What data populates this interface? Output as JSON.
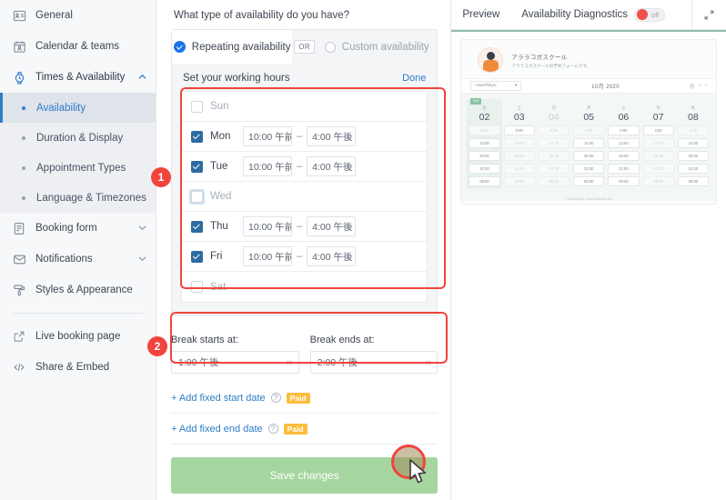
{
  "sidebar": {
    "items": [
      {
        "label": "General",
        "icon": "id-card-icon",
        "type": "group"
      },
      {
        "label": "Calendar & teams",
        "icon": "calendar-person-icon",
        "type": "group"
      },
      {
        "label": "Times & Availability",
        "icon": "watch-icon",
        "type": "group",
        "expanded": true,
        "chevron": "⌃"
      }
    ],
    "sub_items": [
      {
        "label": "Availability",
        "selected": true
      },
      {
        "label": "Duration & Display",
        "selected": false
      },
      {
        "label": "Appointment Types",
        "selected": false
      },
      {
        "label": "Language & Timezones",
        "selected": false
      }
    ],
    "items_after": [
      {
        "label": "Booking form",
        "icon": "form-icon",
        "chevron": "⌄"
      },
      {
        "label": "Notifications",
        "icon": "envelope-icon",
        "chevron": "⌄"
      },
      {
        "label": "Styles & Appearance",
        "icon": "paint-roller-icon",
        "chevron": ""
      }
    ],
    "items_bottom": [
      {
        "label": "Live booking page",
        "icon": "external-link-icon"
      },
      {
        "label": "Share & Embed",
        "icon": "code-icon"
      }
    ]
  },
  "main": {
    "question": "What type of availability do you have?",
    "segments": {
      "repeating": "Repeating availability",
      "or": "OR",
      "custom": "Custom availability"
    },
    "working_hours_title": "Set your working hours",
    "done_label": "Done",
    "days": [
      {
        "day": "Sun",
        "checked": false,
        "focused": false,
        "start": "",
        "end": ""
      },
      {
        "day": "Mon",
        "checked": true,
        "focused": false,
        "start": "10:00 午前",
        "end": "4:00 午後"
      },
      {
        "day": "Tue",
        "checked": true,
        "focused": false,
        "start": "10:00 午前",
        "end": "4:00 午後"
      },
      {
        "day": "Wed",
        "checked": false,
        "focused": true,
        "start": "",
        "end": ""
      },
      {
        "day": "Thu",
        "checked": true,
        "focused": false,
        "start": "10:00 午前",
        "end": "4:00 午後"
      },
      {
        "day": "Fri",
        "checked": true,
        "focused": false,
        "start": "10:00 午前",
        "end": "4:00 午後"
      },
      {
        "day": "Sat",
        "checked": false,
        "focused": false,
        "start": "",
        "end": ""
      }
    ],
    "dash": "–",
    "break": {
      "start_label": "Break starts at:",
      "end_label": "Break ends at:",
      "start_value": "1:00 午後",
      "end_value": "2:00 午後",
      "clear_icon": "×"
    },
    "add_rows": [
      {
        "label": "+ Add fixed start date",
        "help": "?",
        "badge": "Paid"
      },
      {
        "label": "+ Add fixed end date",
        "help": "?",
        "badge": "Paid"
      }
    ],
    "save_label": "Save changes",
    "annotations": [
      {
        "number": "1"
      },
      {
        "number": "2"
      }
    ]
  },
  "right_panel": {
    "tab_preview": "Preview",
    "tab_diagnostics": "Availability Diagnostics",
    "toggle_label": "off",
    "expand_icon": "expand-icon",
    "preview": {
      "title": "アララコガスクール",
      "subtitle": "アララコガスクールの予約フォームです。",
      "timezone": "Asia/Tokyo",
      "month": "10月 2020",
      "view_label": "月",
      "prev": "‹",
      "next": "›",
      "badge": "今日",
      "columns": [
        {
          "dow": "金",
          "day": "02",
          "selected": true,
          "slots": [
            "0:00",
            "14:00",
            "20:00",
            "21:00",
            "08:00"
          ],
          "slot_on": [
            false,
            true,
            true,
            true,
            true
          ]
        },
        {
          "dow": "土",
          "day": "03",
          "selected": false,
          "slots": [
            "0:00",
            "14:00",
            "20:00",
            "21:00",
            "08:00"
          ],
          "slot_on": [
            true,
            false,
            false,
            false,
            false
          ]
        },
        {
          "dow": "日",
          "day": "04",
          "selected": false,
          "dim": true,
          "slots": [
            "0:00",
            "14:00",
            "20:00",
            "21:00",
            "08:00"
          ],
          "slot_on": [
            false,
            false,
            false,
            false,
            false
          ]
        },
        {
          "dow": "月",
          "day": "05",
          "selected": false,
          "slots": [
            "0:00",
            "14:00",
            "20:00",
            "21:00",
            "08:00"
          ],
          "slot_on": [
            false,
            true,
            true,
            true,
            true
          ]
        },
        {
          "dow": "火",
          "day": "06",
          "selected": false,
          "slots": [
            "0:00",
            "14:00",
            "20:00",
            "21:00",
            "08:00"
          ],
          "slot_on": [
            true,
            true,
            true,
            true,
            true
          ]
        },
        {
          "dow": "水",
          "day": "07",
          "selected": false,
          "slots": [
            "0:00",
            "14:00",
            "20:00",
            "21:00",
            "08:00"
          ],
          "slot_on": [
            true,
            false,
            false,
            false,
            false
          ]
        },
        {
          "dow": "木",
          "day": "08",
          "selected": false,
          "slots": [
            "0:00",
            "14:00",
            "20:00",
            "21:00",
            "08:00"
          ],
          "slot_on": [
            false,
            true,
            true,
            true,
            true
          ]
        }
      ],
      "footer": "Powered by YouCanBook.me"
    }
  },
  "colors": {
    "accent_blue": "#2f7cc7",
    "checkbox_blue": "#2d6ca2",
    "annotation_red": "#f1443c",
    "save_green": "#a5d6a0",
    "paid_yellow": "#fbbd3c",
    "toggle_red": "#f0504a"
  }
}
